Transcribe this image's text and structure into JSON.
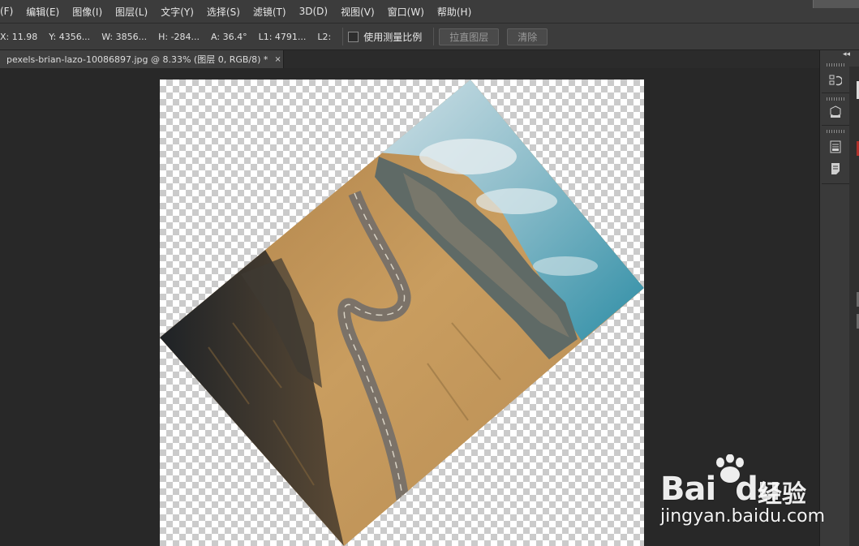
{
  "menu": {
    "items": [
      "(F)",
      "编辑(E)",
      "图像(I)",
      "图层(L)",
      "文字(Y)",
      "选择(S)",
      "滤镜(T)",
      "3D(D)",
      "视图(V)",
      "窗口(W)",
      "帮助(H)"
    ]
  },
  "options": {
    "x": "X: 11.98",
    "y": "Y: 4356...",
    "w": "W: 3856...",
    "h": "H: -284...",
    "a": "A: 36.4°",
    "l1": "L1: 4791...",
    "l2": "L2:",
    "use_measure_scale": "使用测量比例",
    "straighten_layer": "拉直图层",
    "clear": "清除"
  },
  "document": {
    "tab_title": "pexels-brian-lazo-10086897.jpg @ 8.33% (图层 0, RGB/8) *",
    "close_glyph": "×",
    "rotation_deg": 36.4
  },
  "panel": {
    "collapse_glyph": "◂◂",
    "icons": [
      "history-icon",
      "3d-cube-icon",
      "properties-icon",
      "notes-icon"
    ]
  },
  "watermark": {
    "brand": "Bai",
    "brand2": "du",
    "cn": "经验",
    "url": "jingyan.baidu.com"
  },
  "colors": {
    "menubar": "#3c3c3c",
    "workspace": "#282828",
    "sky": "#3a98ad",
    "field": "#c89a5a"
  }
}
